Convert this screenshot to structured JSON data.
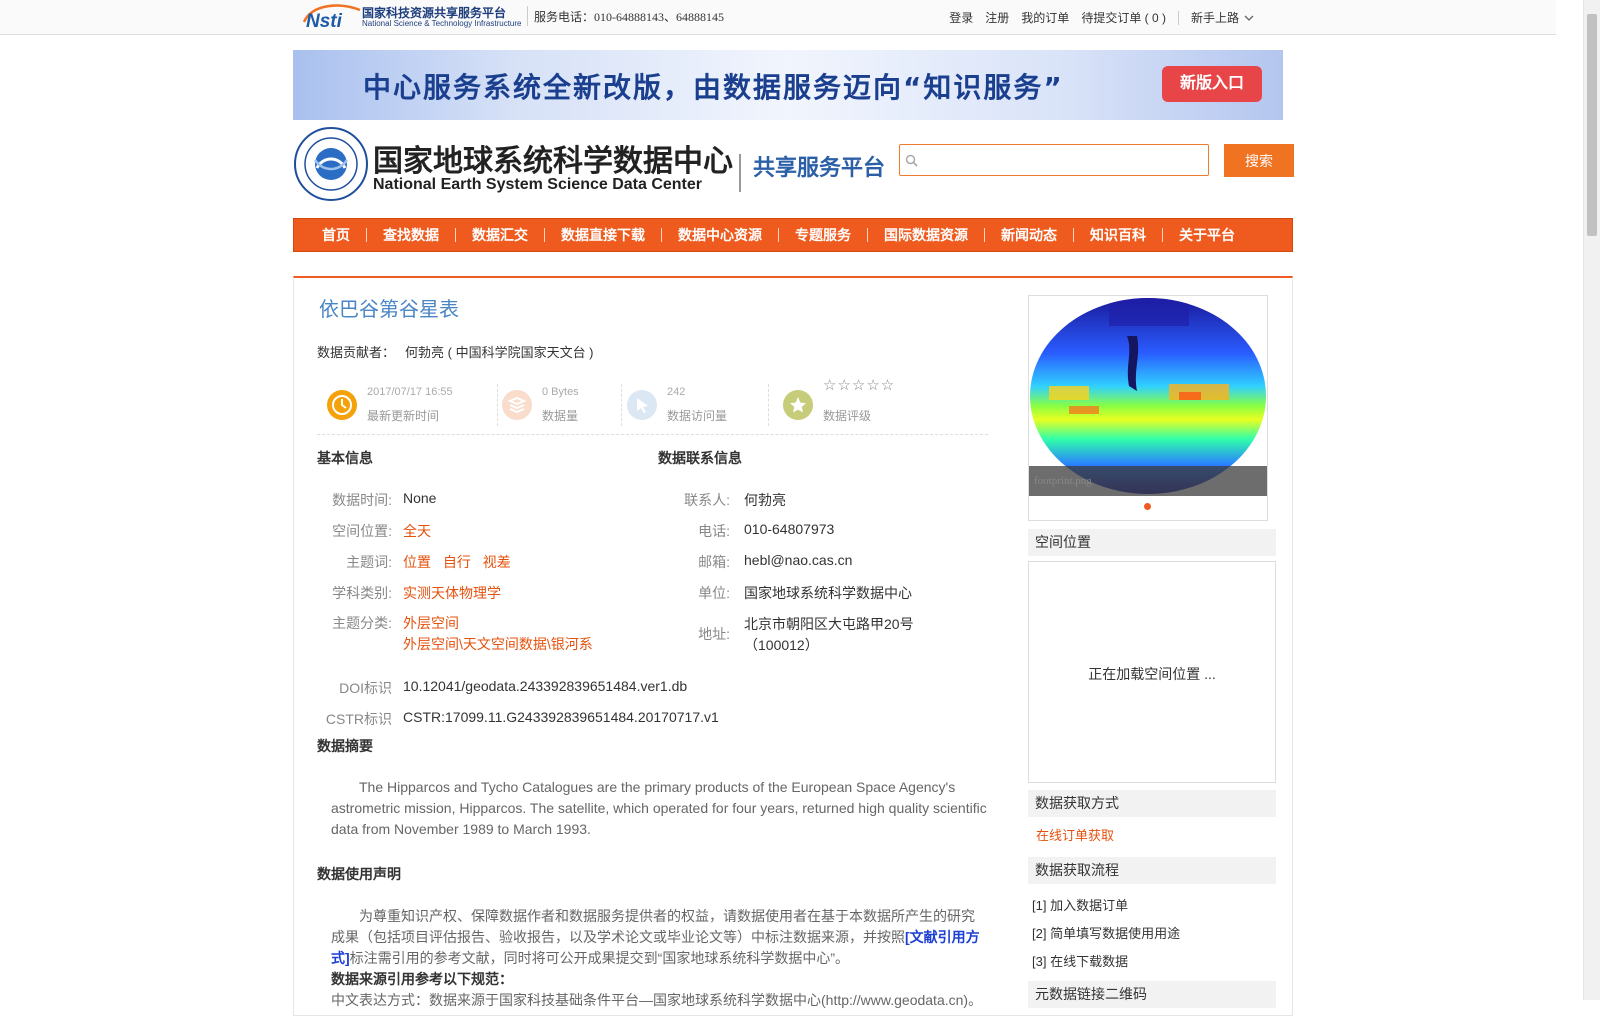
{
  "topbar": {
    "logo_cn": "国家科技资源共享服务平台",
    "logo_en": "National Science & Technology Infrastructure",
    "phone": "服务电话：010-64888143、64888145",
    "links": [
      "登录",
      "注册",
      "我的订单",
      "待提交订单 ( 0 )"
    ],
    "newbie": "新手上路"
  },
  "banner": {
    "text": "中心服务系统全新改版，由数据服务迈向“知识服务”",
    "button": "新版入口"
  },
  "header": {
    "org_cn": "国家地球系统科学数据中心",
    "org_en": "National Earth System Science Data Center",
    "subtitle": "共享服务平台",
    "search_placeholder": "",
    "search_button": "搜索"
  },
  "nav": [
    "首页",
    "查找数据",
    "数据汇交",
    "数据直接下载",
    "数据中心资源",
    "专题服务",
    "国际数据资源",
    "新闻动态",
    "知识百科",
    "关于平台"
  ],
  "dataset": {
    "title": "依巴谷第谷星表",
    "contributor_label": "数据贡献者：",
    "contributor": "何勃亮 ( 中国科学院国家天文台 )",
    "stats": {
      "updated_value": "2017/07/17 16:55",
      "updated_label": "最新更新时间",
      "size_value": "0 Bytes",
      "size_label": "数据量",
      "visits_value": "242",
      "visits_label": "数据访问量",
      "rating_stars": "☆☆☆☆☆",
      "rating_value": 0,
      "rating_label": "数据评级"
    },
    "basic": {
      "heading": "基本信息",
      "time_label": "数据时间:",
      "time_value": "None",
      "space_label": "空间位置:",
      "space_value": "全天",
      "keywords_label": "主题词:",
      "keywords": [
        "位置",
        "自行",
        "视差"
      ],
      "discipline_label": "学科类别:",
      "discipline_value": "实测天体物理学",
      "category_label": "主题分类:",
      "category_1": "外层空间",
      "category_2": "外层空间\\天文空间数据\\银河系",
      "doi_label": "DOI标识",
      "doi_value": "10.12041/geodata.243392839651484.ver1.db",
      "cstr_label": "CSTR标识",
      "cstr_value": "CSTR:17099.11.G243392839651484.20170717.v1"
    },
    "contact": {
      "heading": "数据联系信息",
      "person_label": "联系人:",
      "person_value": "何勃亮",
      "phone_label": "电话:",
      "phone_value": "010-64807973",
      "email_label": "邮箱:",
      "email_value": "hebl@nao.cas.cn",
      "unit_label": "单位:",
      "unit_value": "国家地球系统科学数据中心",
      "address_label": "地址:",
      "address_1": "北京市朝阳区大屯路甲20号",
      "address_2": "（100012）"
    },
    "abstract_heading": "数据摘要",
    "abstract_l1": "The Hipparcos and Tycho Catalogues are the primary products of the European Space Agency's",
    "abstract_l2": "astrometric mission, Hipparcos. The satellite, which operated for four years, returned high quality scientific",
    "abstract_l3": "data from November 1989 to March 1993.",
    "usage_heading": "数据使用声明",
    "usage_l1": "为尊重知识产权、保障数据作者和数据服务提供者的权益，请数据使用者在基于本数据所产生的研究",
    "usage_l2a": "成果（包括项目评估报告、验收报告，以及学术论文或毕业论文等）中标注数据来源，并按照",
    "usage_l2b": "[文献引用方",
    "usage_l3a": "式]",
    "usage_l3b": "标注需引用的参考文献，同时将可公开成果提交到“国家地球系统科学数据中心”。",
    "cite_heading": "数据来源引用参考以下规范：",
    "cite_l1": "中文表达方式：数据来源于国家科技基础条件平台—国家地球系统科学数据中心(http://www.geodata.cn)。"
  },
  "sidebar": {
    "footprint_caption": "footprint.png",
    "spatial_heading": "空间位置",
    "spatial_loading": "正在加载空间位置 ...",
    "access_heading": "数据获取方式",
    "access_link": "在线订单获取",
    "process_heading": "数据获取流程",
    "steps": [
      "[1] 加入数据订单",
      "[2] 简单填写数据使用用途",
      "[3] 在线下载数据"
    ],
    "qr_heading": "元数据链接二维码"
  },
  "colors": {
    "accent": "#f05a23",
    "link_blue": "#1c3fd4",
    "title_blue": "#4b86c4"
  }
}
